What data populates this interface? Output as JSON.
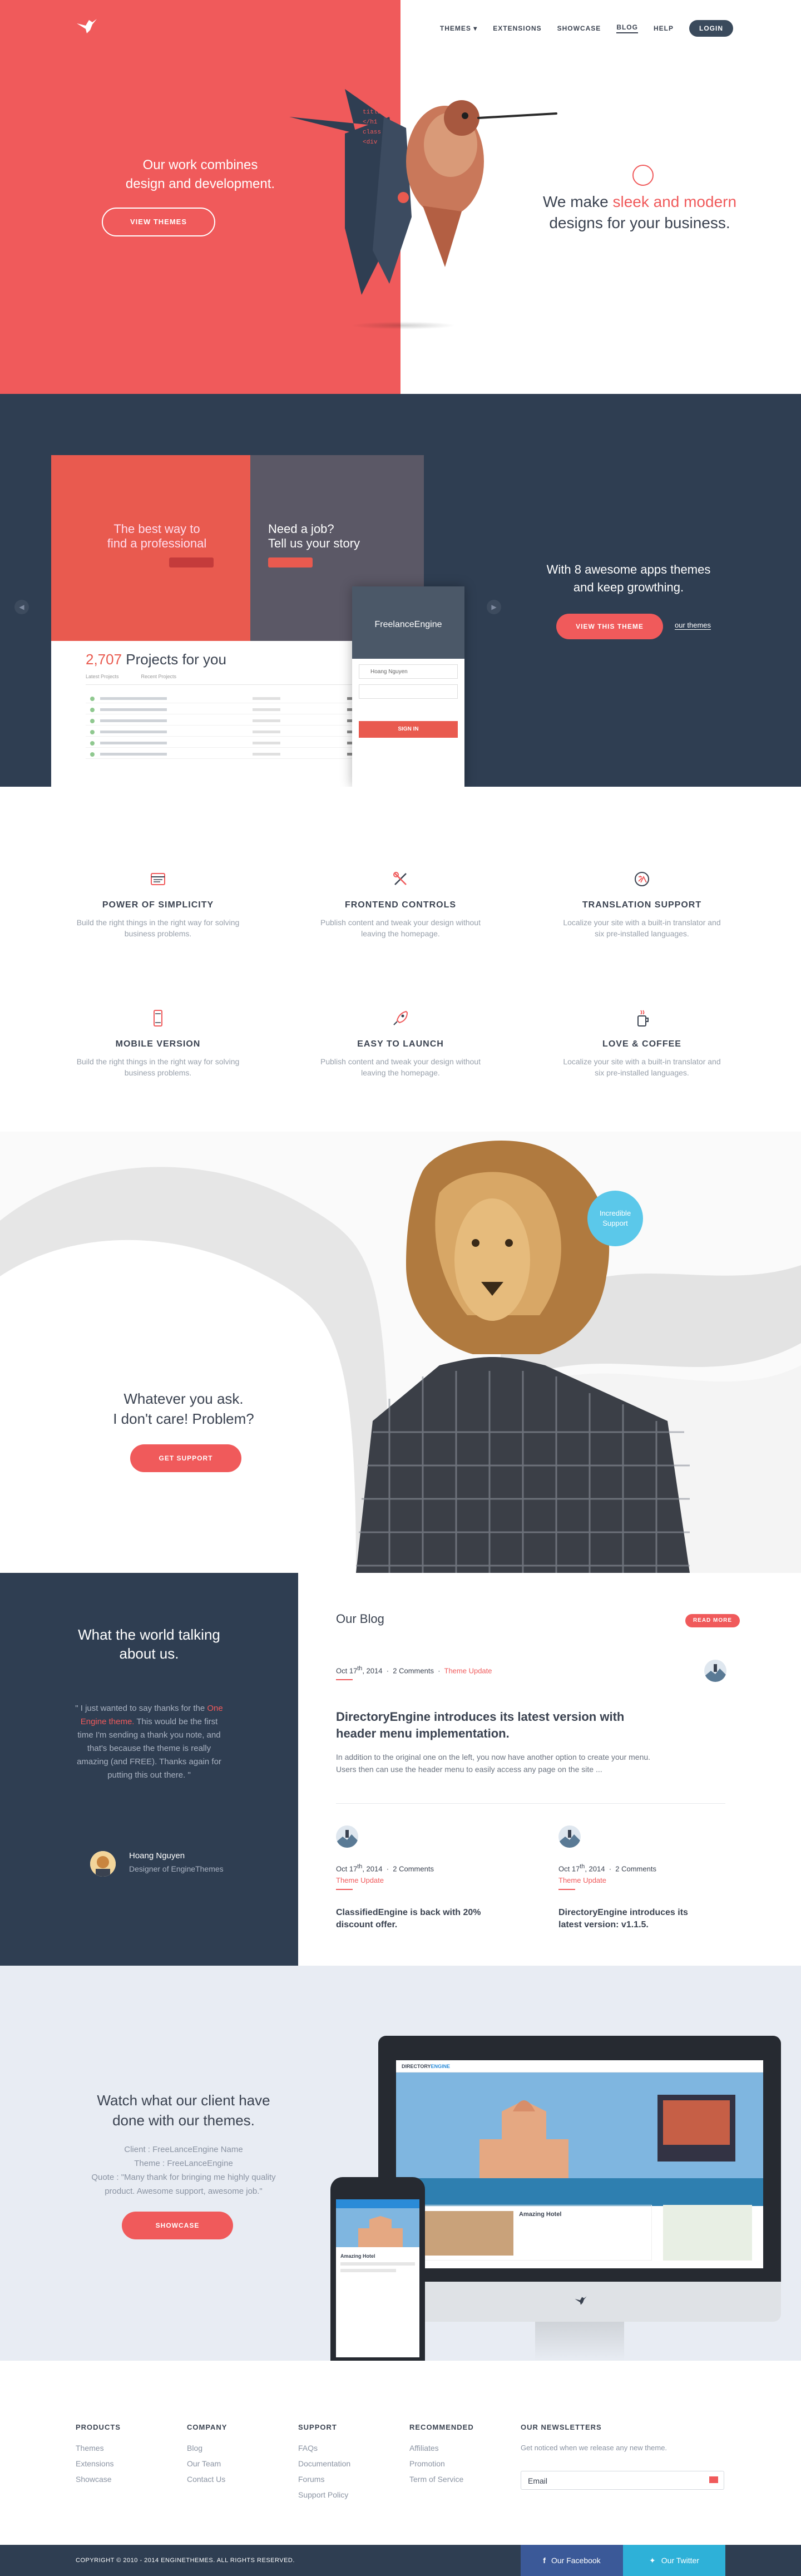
{
  "nav": {
    "items": [
      "THEMES ▾",
      "EXTENSIONS",
      "SHOWCASE",
      "BLOG",
      "HELP"
    ],
    "login": "LOGIN"
  },
  "hero": {
    "left_line1": "Our work combines",
    "left_line2": "design and development.",
    "left_button": "VIEW THEMES",
    "right_pre": "We make ",
    "right_accent": "sleek and modern",
    "right_post": "designs for your business.",
    "code_lines": [
      "<!--",
      "title=Flo",
      "</h1",
      "class",
      "<div"
    ]
  },
  "slider": {
    "line1": "With 8 awesome apps themes",
    "line2": "and keep growthing.",
    "button": "VIEW THIS THEME",
    "link": "our themes",
    "mock": {
      "left_heading_1": "The best way to",
      "left_heading_2": "find a professional",
      "right_heading_1": "Need a job?",
      "right_heading_2": "Tell us your story",
      "projects_num": "2,707",
      "projects_text": " Projects for you",
      "tab1": "Latest Projects",
      "tab2": "Recent Projects",
      "phone_title": "FreelanceEngine",
      "phone_field": "Hoang Nguyen",
      "phone_signin": "SIGN IN"
    }
  },
  "features": [
    {
      "title": "POWER OF SIMPLICITY",
      "desc": "Build the right things in the right way for solving business problems.",
      "icon": "browser-icon"
    },
    {
      "title": "FRONTEND CONTROLS",
      "desc": "Publish content and tweak your design without leaving the homepage.",
      "icon": "tools-icon"
    },
    {
      "title": "TRANSLATION SUPPORT",
      "desc": "Localize your site with a built-in translator and six pre-installed languages.",
      "icon": "translate-icon"
    },
    {
      "title": "MOBILE VERSION",
      "desc": "Build the right things in the right way for solving business problems.",
      "icon": "mobile-icon"
    },
    {
      "title": "EASY TO LAUNCH",
      "desc": "Publish content and tweak your design without leaving the homepage.",
      "icon": "rocket-icon"
    },
    {
      "title": "LOVE & COFFEE",
      "desc": "Localize your site with a built-in translator and six pre-installed languages.",
      "icon": "coffee-icon"
    }
  ],
  "support": {
    "line1": "Whatever you ask.",
    "line2": "I don't care! Problem?",
    "button": "GET SUPPORT",
    "bubble_1": "Incredible",
    "bubble_2": "Support"
  },
  "testimonial": {
    "heading_1": "What the world talking",
    "heading_2": "about us.",
    "quote_pre": "\" I just wanted to say thanks for the ",
    "quote_hl": "One Engine theme.",
    "quote_post": " This would be the first time I'm sending a thank you note, and that's because the theme is really amazing (and FREE). Thanks again for putting this out there. \"",
    "author": "Hoang Nguyen",
    "role": "Designer of EngineThemes"
  },
  "blog": {
    "title": "Our Blog",
    "read_more": "READ MORE",
    "featured": {
      "date_day": "Oct 17",
      "date_sup": "th",
      "date_year": ", 2014",
      "comments": "2 Comments",
      "category": "Theme Update",
      "title_1": "DirectoryEngine introduces its latest version with",
      "title_2": "header menu implementation.",
      "excerpt_1": "In addition to the original one on the left, you now have another option to create your menu.",
      "excerpt_2": "Users then can use the header menu to easily access any page on the site ..."
    },
    "posts": [
      {
        "date_day": "Oct 17",
        "date_sup": "th",
        "date_year": ", 2014",
        "comments": "2 Comments",
        "category": "Theme Update",
        "title_1": "ClassifiedEngine is back with 20%",
        "title_2": "discount offer."
      },
      {
        "date_day": "Oct 17",
        "date_sup": "th",
        "date_year": ", 2014",
        "comments": "2 Comments",
        "category": "Theme Update",
        "title_1": "DirectoryEngine introduces its",
        "title_2": "latest version: v1.1.5."
      }
    ]
  },
  "client": {
    "line1": "Watch what our client have",
    "line2": "done with our themes.",
    "client": "Client : FreeLanceEngine Name",
    "theme": "Theme : FreeLanceEngine",
    "quote_1": "Quote : \"Many thank for bringing me highly quality",
    "quote_2": "product. Awesome support, awesome job.\"",
    "button": "SHOWCASE",
    "site_brand_1": "DIRECTORY",
    "site_brand_2": "ENGINE",
    "site_item": "Amazing Hotel"
  },
  "footer": {
    "columns": [
      {
        "title": "PRODUCTS",
        "links": [
          "Themes",
          "Extensions",
          "Showcase"
        ]
      },
      {
        "title": "COMPANY",
        "links": [
          "Blog",
          "Our Team",
          "Contact Us"
        ]
      },
      {
        "title": "SUPPORT",
        "links": [
          "FAQs",
          "Documentation",
          "Forums",
          "Support Policy"
        ]
      },
      {
        "title": "RECOMMENDED",
        "links": [
          "Affiliates",
          "Promotion",
          "Term of Service"
        ]
      }
    ],
    "newsletter_title": "OUR NEWSLETTERS",
    "newsletter_desc": "Get noticed when we release any new theme.",
    "email_placeholder": "Email",
    "copyright": "COPYRIGHT © 2010 - 2014 ENGINETHEMES. ALL RIGHTS RESERVED.",
    "facebook": "Our Facebook",
    "twitter": "Our Twitter"
  },
  "colors": {
    "accent": "#f05a5b",
    "navy": "#2f3e52",
    "light_bg": "#e8ecf3"
  }
}
